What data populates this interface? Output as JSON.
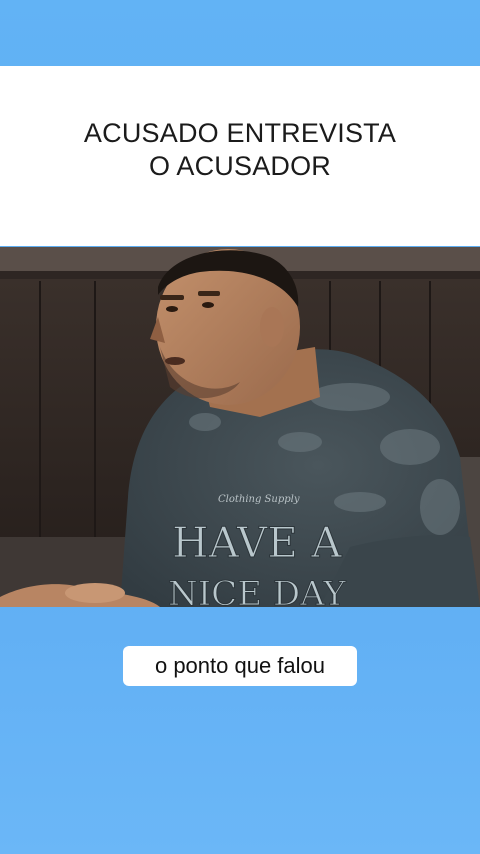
{
  "title": {
    "line1": "ACUSADO ENTREVISTA",
    "line2": "O ACUSADOR"
  },
  "video": {
    "shirt_text_line1": "HAVE A",
    "shirt_text_line2": "NICE DAY",
    "shirt_script": "Clothing Supply"
  },
  "caption": "o ponto que falou",
  "colors": {
    "background_blue": "#5aaaf2",
    "panel_white": "#ffffff",
    "shirt_gray": "#3e4a50"
  }
}
